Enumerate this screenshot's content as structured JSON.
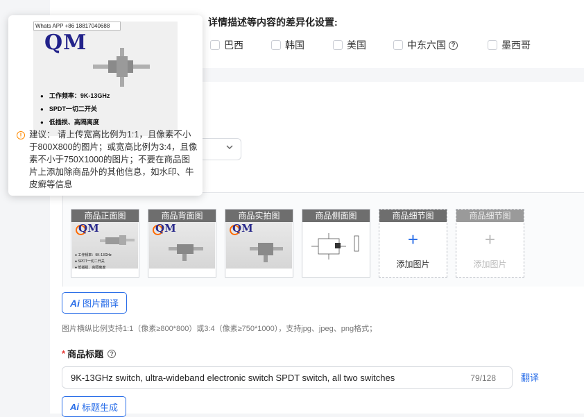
{
  "diff_settings": {
    "title": "详情描述等内容的差异化设置:",
    "countries": [
      {
        "label": "巴西",
        "checked": false
      },
      {
        "label": "韩国",
        "checked": false
      },
      {
        "label": "美国",
        "checked": false
      },
      {
        "label": "中东六国",
        "checked": false,
        "help": true
      },
      {
        "label": "墨西哥",
        "checked": false
      }
    ]
  },
  "image_slots": [
    {
      "label": "商品正面图",
      "filled": true
    },
    {
      "label": "商品背面图",
      "filled": true
    },
    {
      "label": "商品实拍图",
      "filled": true
    },
    {
      "label": "商品侧面图",
      "filled": true
    },
    {
      "label": "商品细节图",
      "filled": false,
      "add_text": "添加图片",
      "enabled": true
    },
    {
      "label": "商品细节图",
      "filled": false,
      "add_text": "添加图片",
      "enabled": false
    }
  ],
  "image_translate_button": {
    "ai": "Ai",
    "label": "图片翻译"
  },
  "image_hint": "图片横纵比例支持1:1（像素≥800*800）或3:4（像素≥750*1000），支持jpg、jpeg、png格式；",
  "product_title": {
    "required_mark": "*",
    "label": "商品标题",
    "value": "9K-13GHz switch, ultra-wideband electronic switch SPDT switch, all two switches",
    "count": "79/128",
    "translate_link": "翻译",
    "generate_button": {
      "ai": "Ai",
      "label": "标题生成"
    }
  },
  "popover": {
    "product_image": {
      "watermark": "Whats APP +86 18817040688",
      "brand": "QM",
      "bullets": [
        "工作频率：9K-13GHz",
        "SPDT一切二开关",
        "低插损、高隔离度"
      ]
    },
    "advice": "建议：  请上传宽高比例为1:1，且像素不小于800X800的图片；或宽高比例为3:4，且像素不小于750X1000的图片；不要在商品图片上添加除商品外的其他信息，如水印、牛皮癣等信息"
  },
  "colors": {
    "accent": "#2a6ee8",
    "required": "#e53935",
    "warning": "#ff8a00"
  }
}
